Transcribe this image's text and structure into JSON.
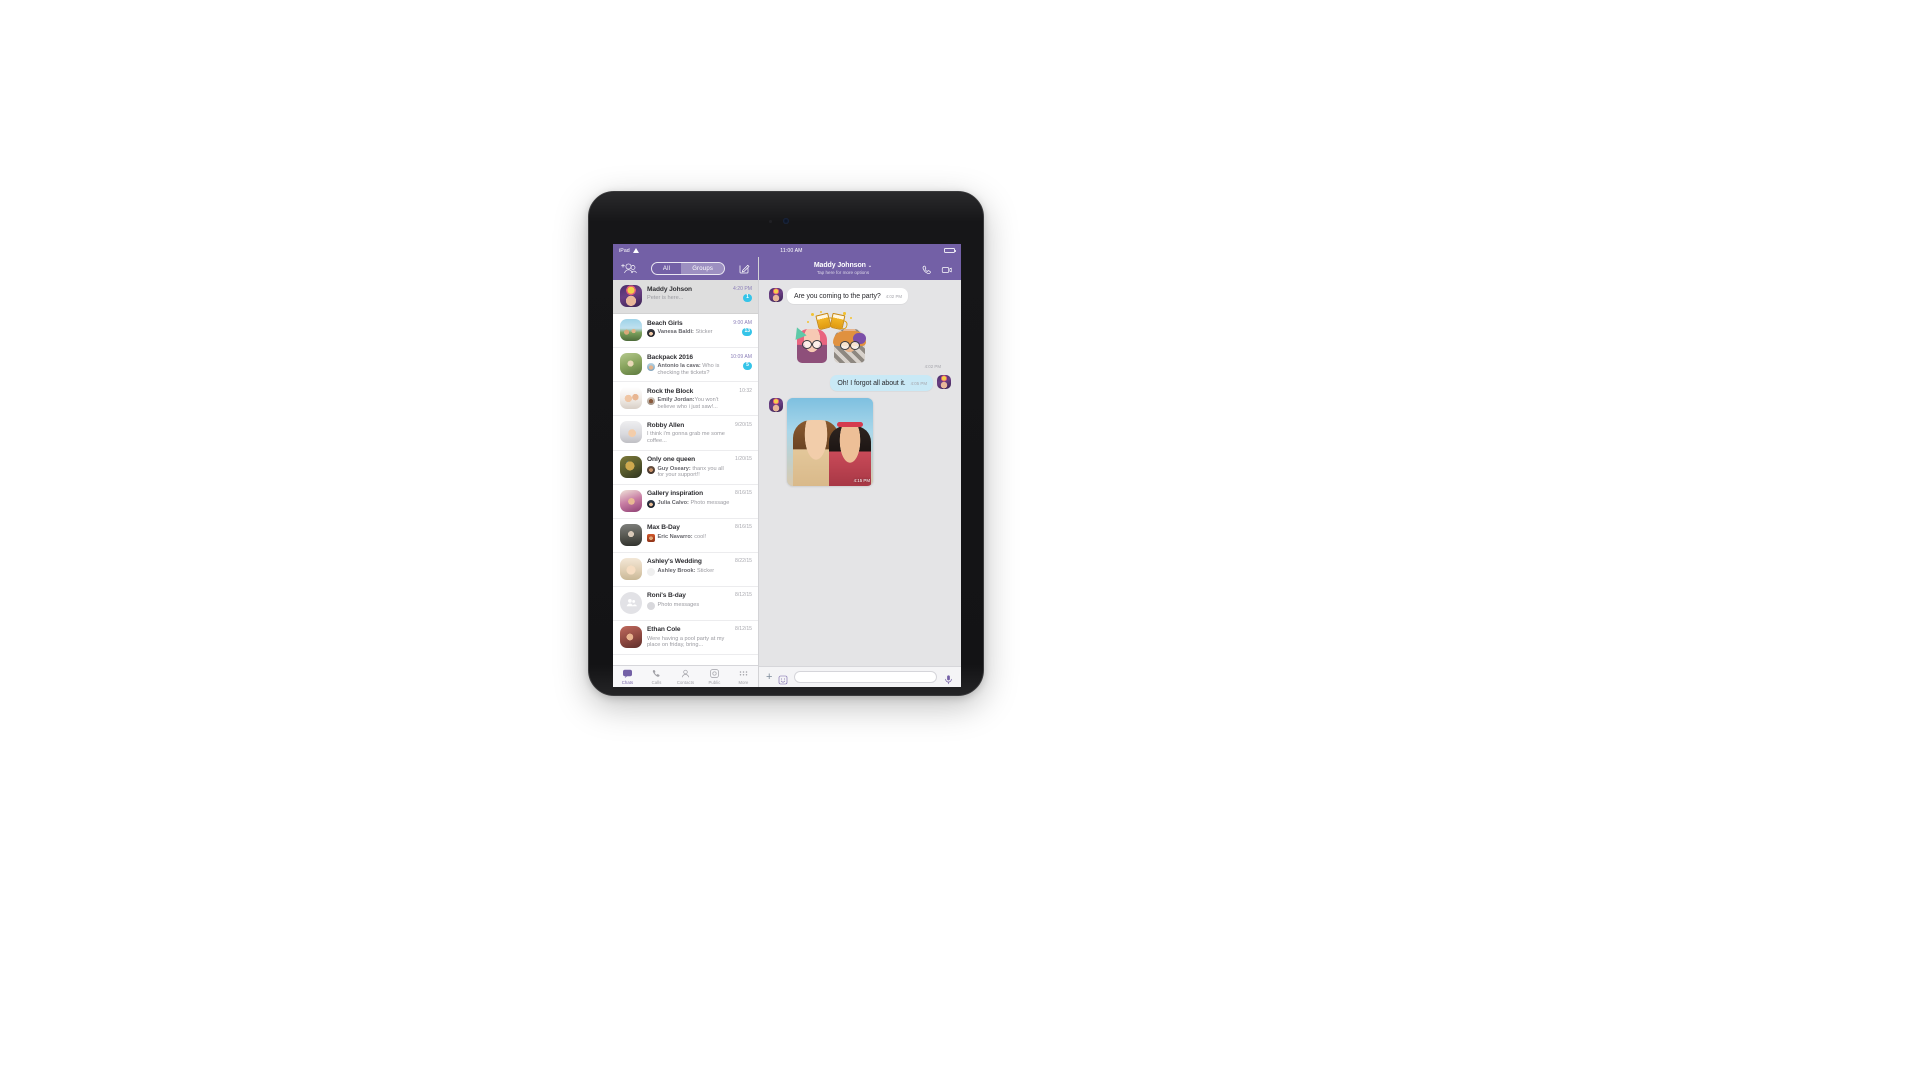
{
  "status_bar": {
    "device_label": "iPad",
    "wifi_icon": "wifi-icon",
    "time": "11:00 AM",
    "battery_icon": "battery-icon"
  },
  "left_pane": {
    "navbar": {
      "add_contact_icon": "add-contact-icon",
      "compose_icon": "compose-icon",
      "segments": [
        {
          "label": "All",
          "active": false
        },
        {
          "label": "Groups",
          "active": true
        }
      ]
    },
    "chats": [
      {
        "name": "Maddy Johson",
        "snippet_who": "",
        "snippet_text": "Peter is here...",
        "time": "4:20 PM",
        "badge": "1",
        "selected": true,
        "has_mini_avatar": false
      },
      {
        "name": "Beach Girls",
        "snippet_who": "Vanesa Baldi:",
        "snippet_text": " Sticker",
        "time": "9:00 AM",
        "badge": "13",
        "selected": false,
        "has_mini_avatar": true
      },
      {
        "name": "Backpack 2016",
        "snippet_who": "Antonio la cava:",
        "snippet_text": " Who is checking the tickets?",
        "time": "10:09 AM",
        "badge": "5",
        "selected": false,
        "has_mini_avatar": true
      },
      {
        "name": "Rock the Block",
        "snippet_who": "Emily Jordan:",
        "snippet_text": "You won't believe who i just saw!...",
        "time": "10:32",
        "badge": "",
        "selected": false,
        "has_mini_avatar": true
      },
      {
        "name": "Robby Allen",
        "snippet_who": "",
        "snippet_text": "I think i'm gonna grab me some coffee...",
        "time": "9/20/15",
        "badge": "",
        "selected": false,
        "has_mini_avatar": false
      },
      {
        "name": "Only one queen",
        "snippet_who": "Guy Oseary:",
        "snippet_text": " thanx you all for your support!!",
        "time": "1/20/15",
        "badge": "",
        "selected": false,
        "has_mini_avatar": true
      },
      {
        "name": "Gallery inspiration",
        "snippet_who": "Julia Calvo:",
        "snippet_text": " Photo message",
        "time": "8/16/15",
        "badge": "",
        "selected": false,
        "has_mini_avatar": true
      },
      {
        "name": "Max B-Day",
        "snippet_who": "Eric Navarro:",
        "snippet_text": " cool!",
        "time": "8/16/15",
        "badge": "",
        "selected": false,
        "has_mini_avatar": true
      },
      {
        "name": "Ashley's Wedding",
        "snippet_who": "Ashley Brook:",
        "snippet_text": " Sticker",
        "time": "8/22/15",
        "badge": "",
        "selected": false,
        "has_mini_avatar": true
      },
      {
        "name": "Roni's B-day",
        "snippet_who": "",
        "snippet_text": "Photo messages",
        "time": "8/12/15",
        "badge": "",
        "selected": false,
        "has_mini_avatar": true
      },
      {
        "name": "Ethan Cole",
        "snippet_who": "",
        "snippet_text": "Were having a pool party at my place on friday, bring...",
        "time": "8/12/15",
        "badge": "",
        "selected": false,
        "has_mini_avatar": false
      }
    ],
    "tabs": [
      {
        "label": "Chats",
        "icon": "chat-bubble-icon",
        "active": true
      },
      {
        "label": "Calls",
        "icon": "phone-icon",
        "active": false
      },
      {
        "label": "Contacts",
        "icon": "contacts-icon",
        "active": false
      },
      {
        "label": "Public",
        "icon": "public-accounts-icon",
        "active": false
      },
      {
        "label": "More",
        "icon": "more-dots-icon",
        "active": false
      }
    ]
  },
  "right_pane": {
    "navbar": {
      "title": "Maddy Johnson",
      "chevron": "⌄",
      "subtitle": "Tap here for more options",
      "call_icon": "phone-call-icon",
      "video_icon": "video-call-icon"
    },
    "messages": [
      {
        "type": "text",
        "direction": "in",
        "text": "Are you coming to the party?",
        "time": "4:02 PM"
      },
      {
        "type": "sticker",
        "direction": "in",
        "sticker_name": "cheers-beer-sticker",
        "time": "4:02 PM"
      },
      {
        "type": "text",
        "direction": "out",
        "text": "Oh! I forgot all about it.",
        "time": "4:05 PM"
      },
      {
        "type": "photo",
        "direction": "in",
        "photo_name": "two-friends-selfie-photo",
        "time": "4:15 PM"
      }
    ],
    "input_bar": {
      "plus_icon": "add-attachment-icon",
      "sticker_icon": "sticker-picker-icon",
      "placeholder": "",
      "value": "",
      "mic_icon": "microphone-icon"
    }
  },
  "colors": {
    "brand_purple": "#7360a6",
    "badge_cyan": "#35c4e8",
    "outgoing_bubble": "#c9e9f6",
    "incoming_bubble": "#ffffff",
    "chat_background": "#e4e4e6"
  }
}
